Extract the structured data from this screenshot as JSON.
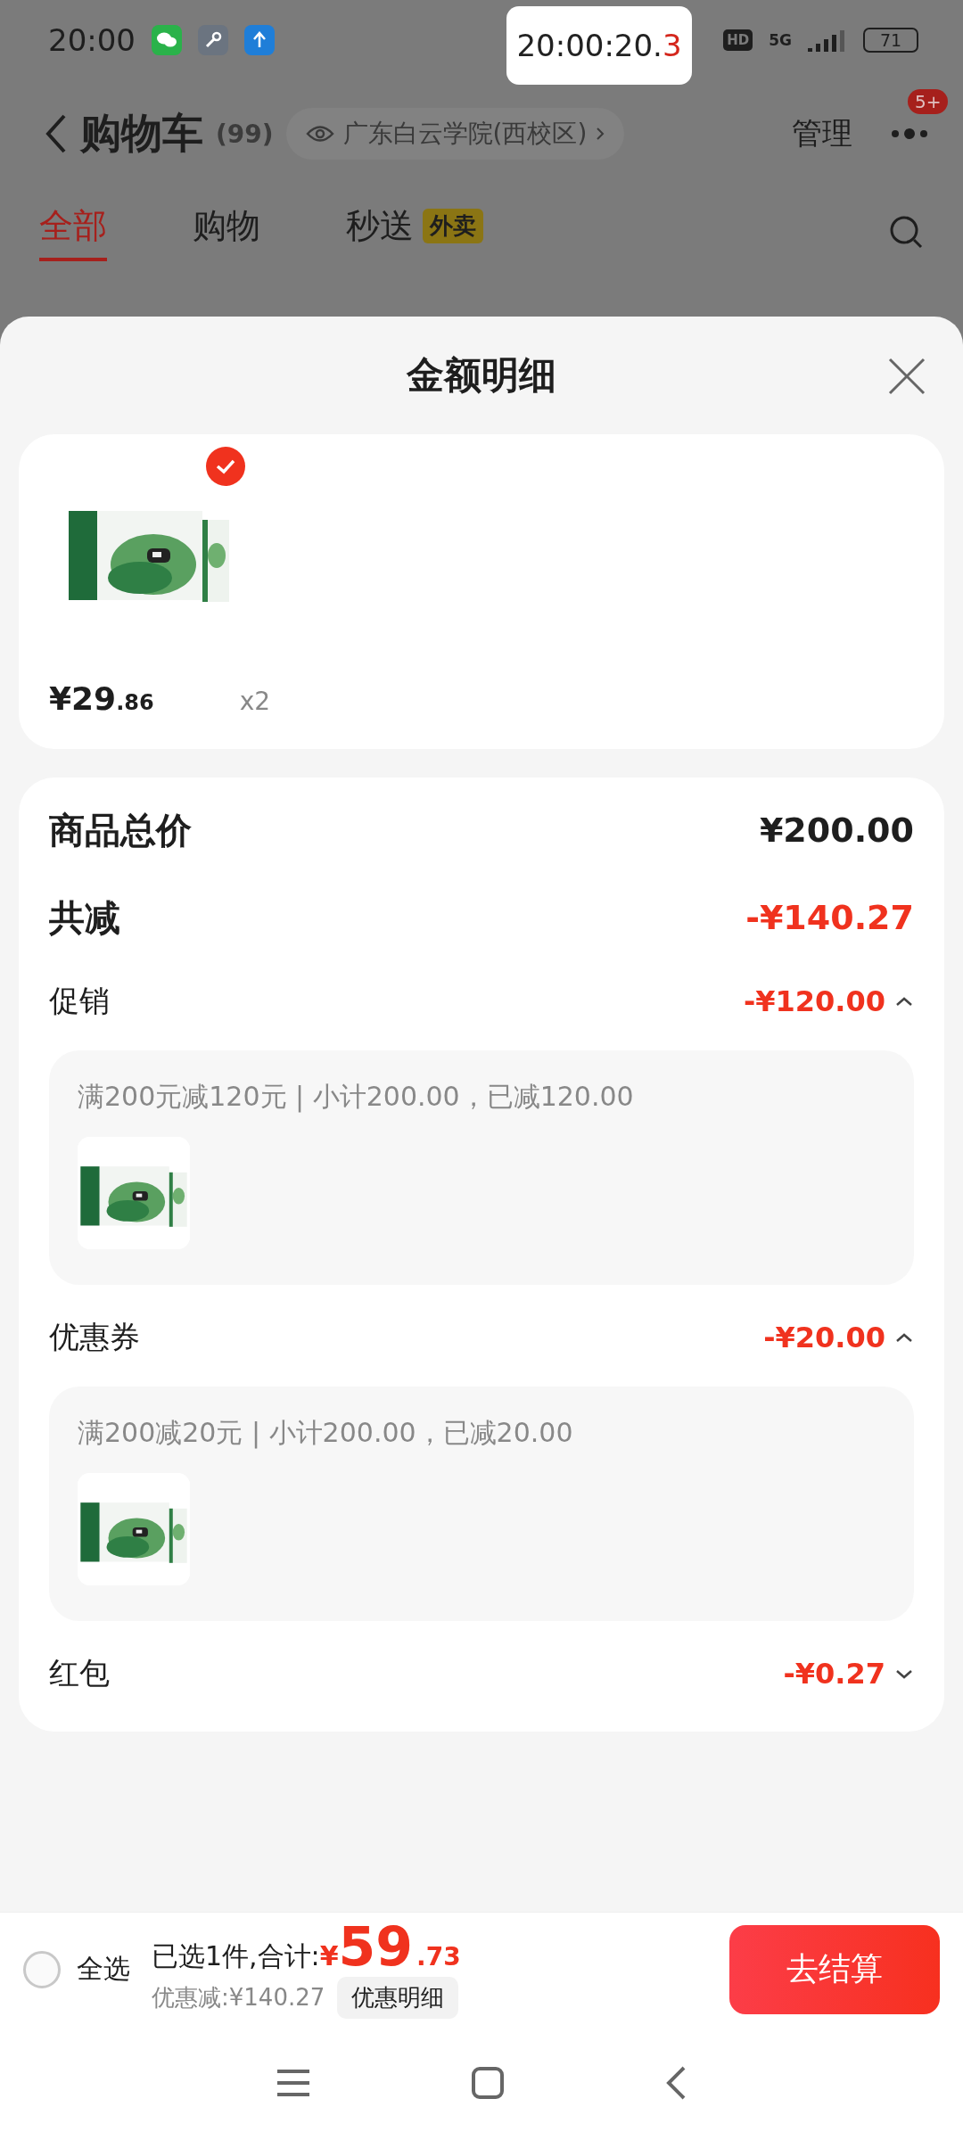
{
  "status_bar": {
    "time": "20:00",
    "hd": "HD",
    "network": "5G",
    "battery": "71"
  },
  "floating_clock": {
    "main": "20:00:20.",
    "fraction": "3"
  },
  "header": {
    "title": "购物车",
    "count": "(99)",
    "location": "广东白云学院(西校区)",
    "manage": "管理",
    "badge": "5+"
  },
  "tabs": [
    {
      "label": "全部",
      "selected": true
    },
    {
      "label": "购物",
      "selected": false
    },
    {
      "label": "秒送",
      "tag": "外卖",
      "selected": false
    }
  ],
  "sheet": {
    "title": "金额明细"
  },
  "product": {
    "checked": true,
    "price_main": "¥29",
    "price_cents": ".86",
    "quantity": "x2"
  },
  "summary": [
    {
      "kind": "total",
      "label": "商品总价",
      "amount": "¥200.00"
    },
    {
      "kind": "discount",
      "label": "共减",
      "amount": "-¥140.27"
    }
  ],
  "discounts": [
    {
      "label": "促销",
      "amount": "-¥120.00",
      "expanded": true,
      "detail": "满200元减120元 | 小计200.00，已减120.00"
    },
    {
      "label": "优惠券",
      "amount": "-¥20.00",
      "expanded": true,
      "detail": "满200减20元 | 小计200.00，已减20.00"
    },
    {
      "label": "红包",
      "amount": "-¥0.27",
      "expanded": false
    }
  ],
  "bottom_bar": {
    "select_all": {
      "label": "全选",
      "checked": false
    },
    "summary": "已选1件,合计:",
    "currency": "¥",
    "total_main": "59",
    "total_cents": ".73",
    "saved": "优惠减:¥140.27",
    "detail_button": "优惠明细",
    "checkout": "去结算"
  }
}
